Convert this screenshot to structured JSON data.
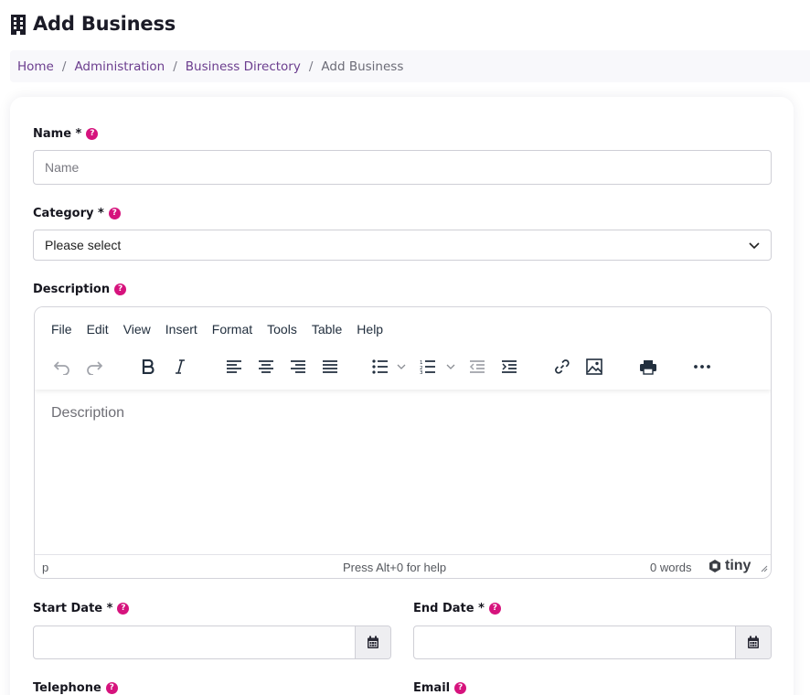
{
  "page": {
    "title": "Add Business",
    "icon": "building-icon"
  },
  "breadcrumb": [
    {
      "label": "Home"
    },
    {
      "label": "Administration"
    },
    {
      "label": "Business Directory"
    },
    {
      "label": "Add Business"
    }
  ],
  "form": {
    "name": {
      "label": "Name *",
      "placeholder": "Name",
      "value": ""
    },
    "category": {
      "label": "Category *",
      "selected": "Please select"
    },
    "description": {
      "label": "Description",
      "placeholder": "Description",
      "menu": [
        "File",
        "Edit",
        "View",
        "Insert",
        "Format",
        "Tools",
        "Table",
        "Help"
      ],
      "status_path": "p",
      "status_help": "Press Alt+0 for help",
      "word_count": "0 words",
      "brand": "tiny"
    },
    "start_date": {
      "label": "Start Date *",
      "value": ""
    },
    "end_date": {
      "label": "End Date *",
      "value": ""
    },
    "telephone": {
      "label": "Telephone"
    },
    "email": {
      "label": "Email"
    }
  },
  "colors": {
    "help_badge": "#d6137d",
    "breadcrumb_link": "#6b3d8e"
  }
}
